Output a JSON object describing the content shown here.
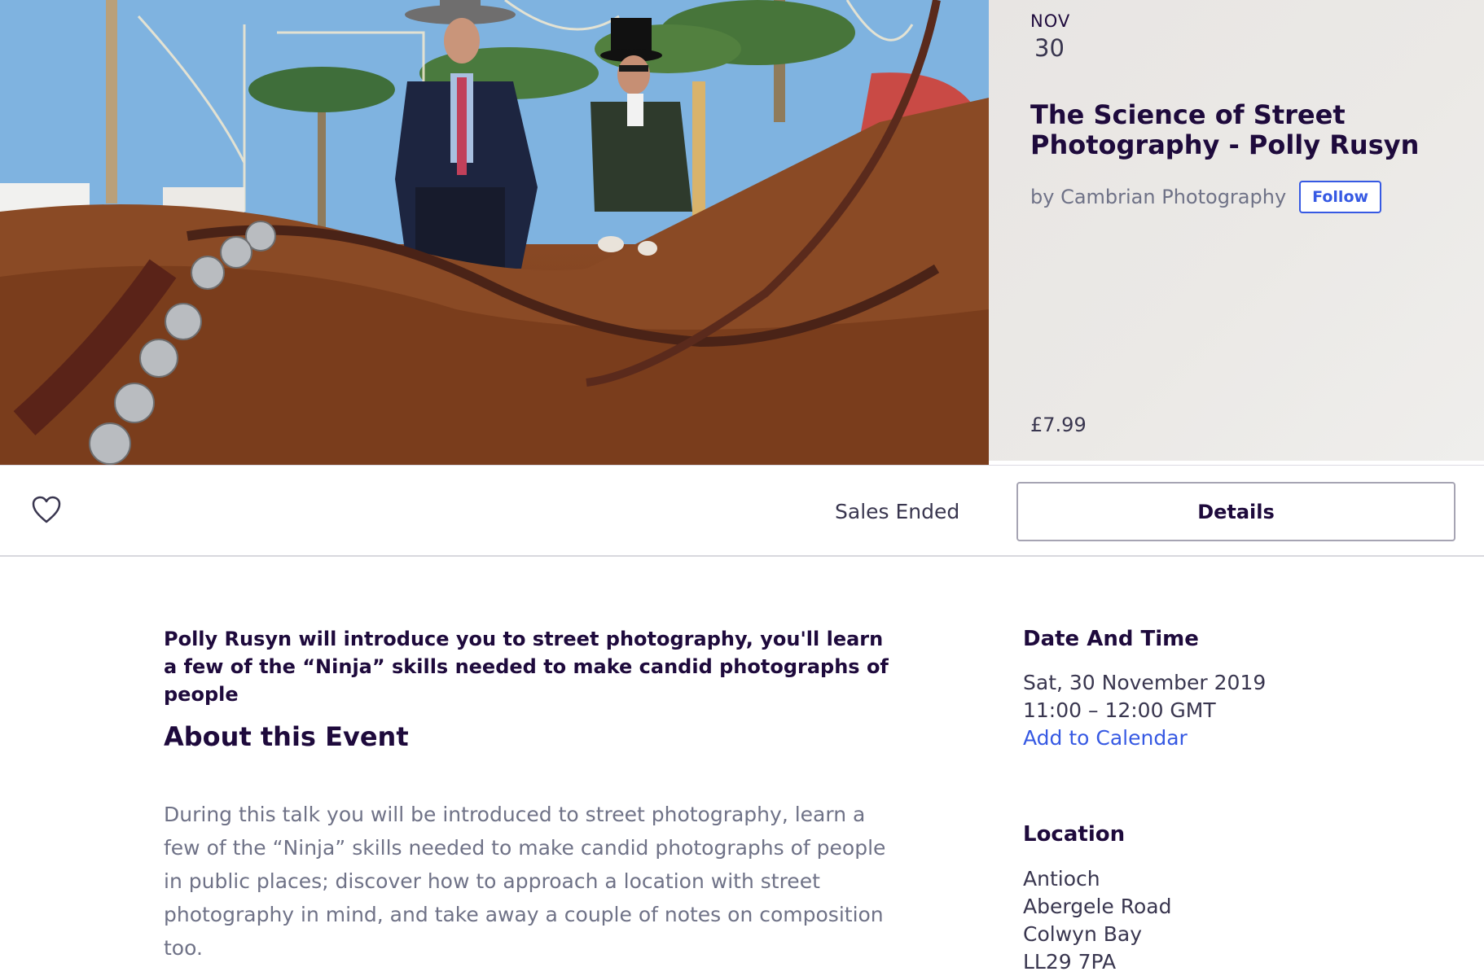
{
  "event": {
    "month": "NOV",
    "day": "30",
    "title": "The Science of Street Photography - Polly Rusyn",
    "organizer": "by Cambrian Photography",
    "follow_label": "Follow",
    "price": "£7.99"
  },
  "action_bar": {
    "status": "Sales Ended",
    "details_label": "Details",
    "icon": "heart-icon"
  },
  "content": {
    "summary": "Polly Rusyn will introduce you to street photography, you'll learn a few of the “Ninja” skills needed to make candid photographs of people",
    "about_heading": "About this Event",
    "description": "During this talk you will be introduced to street photography, learn a few of the “Ninja” skills needed to make candid photographs of people in public places; discover how to approach a location with street photography in mind, and take away a couple of notes on composition too."
  },
  "sidebar": {
    "date_heading": "Date And Time",
    "date_line": "Sat, 30 November 2019",
    "time_line": "11:00 – 12:00 GMT",
    "calendar_link": "Add to Calendar",
    "location_heading": "Location",
    "address": [
      "Antioch",
      "Abergele Road",
      "Colwyn Bay",
      "LL29 7PA"
    ]
  },
  "colors": {
    "brand_blue": "#3659e3",
    "heading": "#1e0a3c",
    "muted": "#6f7287"
  }
}
